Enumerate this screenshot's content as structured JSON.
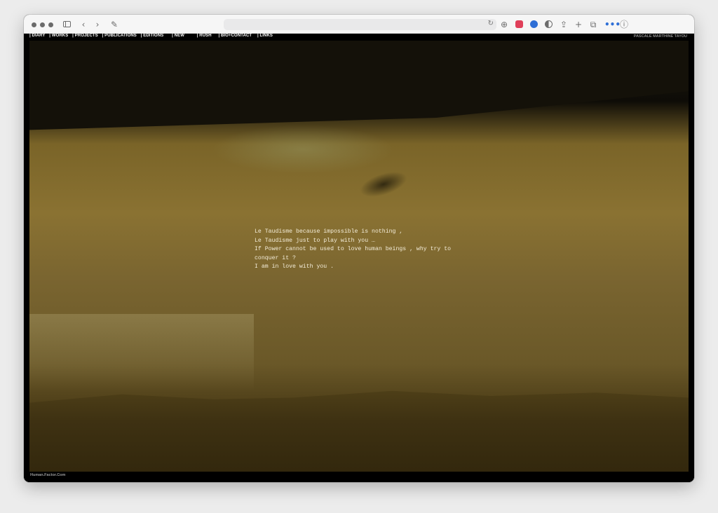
{
  "browser": {
    "address_text": "",
    "icons": {
      "sidebar": "sidebar-icon",
      "back": "back-icon",
      "forward": "forward-icon",
      "tab_overview": "tab-overview-icon",
      "reload": "reload-icon",
      "download": "download-icon",
      "pocket": "pocket-icon",
      "password": "password-icon",
      "reader": "reader-icon",
      "share": "share-icon",
      "new_tab": "plus-icon",
      "tabs": "tabs-icon",
      "extension": "extension-icon",
      "info": "info-icon"
    },
    "glyphs": {
      "back": "‹",
      "forward": "›",
      "reload": "↻",
      "download": "⊕",
      "share": "⇪",
      "new_tab": "+",
      "tabs": "⧉",
      "info": "ⓘ",
      "tab_overview": "✎"
    },
    "colors": {
      "pocket": "#e0405a",
      "password": "#2f6fd6",
      "extension": "#2f6fd6"
    }
  },
  "site": {
    "nav": [
      "| DIARY",
      "| WORKS",
      "| PROJECTS",
      "| PUBLICATIONS",
      "| EDITIONS",
      "| NEW",
      "| RUSH",
      "| BIO+CONTACT",
      "| LINKS"
    ],
    "title": "PASCALE MARTHINE TAYOU",
    "poem": [
      "Le Taudisme because impossible is nothing ,",
      "Le Taudisme just to play with you …",
      "If Power cannot be used to love human beings , why try to",
      "conquer it ?",
      "I am in love with you ."
    ],
    "footer": "Human.Factor.Com"
  }
}
